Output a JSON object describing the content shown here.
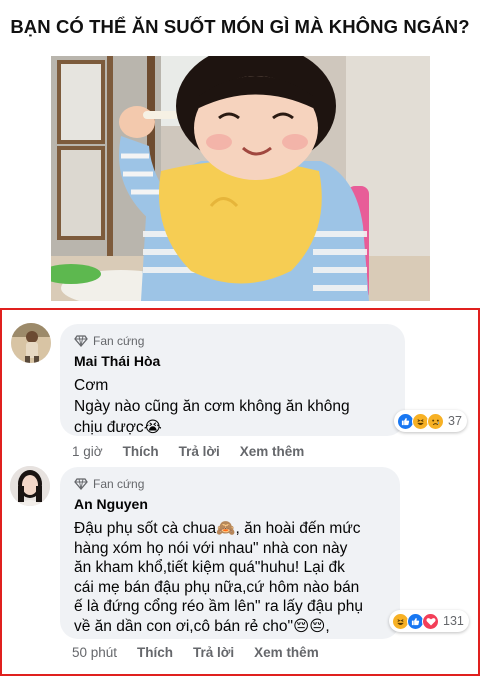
{
  "headline": "BẠN CÓ THỂ ĂN SUỐT MÓN GÌ MÀ KHÔNG NGÁN?",
  "comments": [
    {
      "badge": "Fan cứng",
      "author": "Mai Thái Hòa",
      "lines": [
        "Cơm",
        "Ngày nào cũng ăn cơm không ăn không",
        "chịu được😭"
      ],
      "reaction_count": "37",
      "time": "1 giờ",
      "like": "Thích",
      "reply": "Trả lời",
      "more": "Xem thêm"
    },
    {
      "badge": "Fan cứng",
      "author": "An Nguyen",
      "lines": [
        "Đậu phụ sốt cà chua🙈, ăn hoài đến mức",
        "hàng xóm họ nói với nhau\" nhà con này",
        "ăn kham khổ,tiết kiệm quá\"huhu! Lại đk",
        "cái mẹ bán đậu phụ nữa,cứ hôm nào bán",
        "ế là đứng cổng réo ầm lên\" ra lấy đậu phụ",
        "về ăn dần con ơi,cô bán rẻ cho\"😔😔,"
      ],
      "reaction_count": "131",
      "time": "50 phút",
      "like": "Thích",
      "reply": "Trả lời",
      "more": "Xem thêm"
    }
  ],
  "colors": {
    "frame_border": "#e0201e",
    "bubble_bg": "#f0f2f5",
    "meta_text": "#65676b",
    "like_blue": "#1877f2",
    "love_red": "#f33e58",
    "haha_yellow": "#f7b125"
  }
}
